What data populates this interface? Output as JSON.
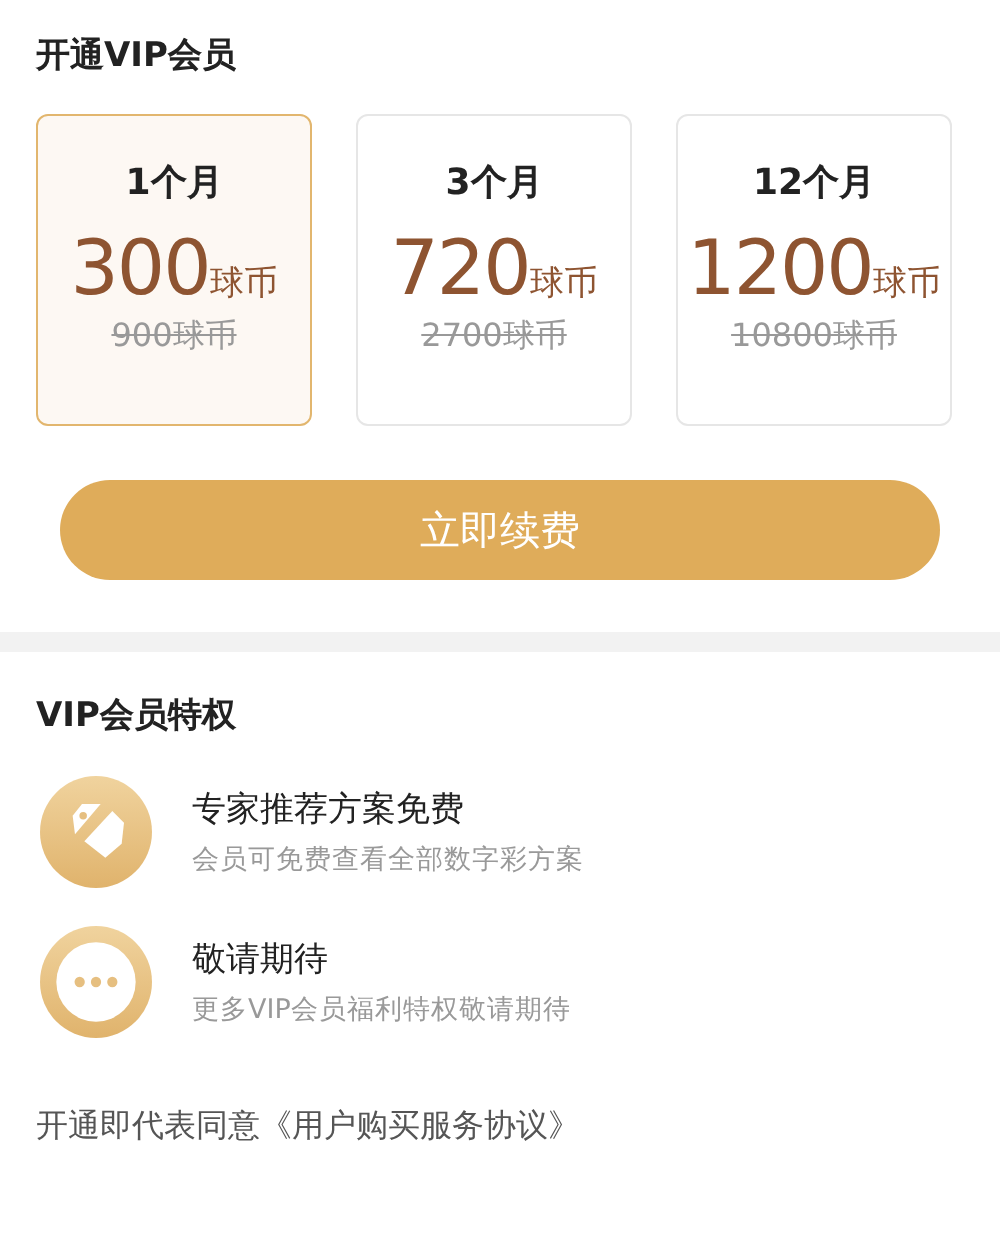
{
  "plan_section": {
    "title": "开通VIP会员",
    "plans": [
      {
        "period": "1个月",
        "price": "300",
        "unit": "球币",
        "original": "900球币",
        "selected": true
      },
      {
        "period": "3个月",
        "price": "720",
        "unit": "球币",
        "original": "2700球币",
        "selected": false
      },
      {
        "period": "12个月",
        "price": "1200",
        "unit": "球币",
        "original": "10800球币",
        "selected": false
      }
    ],
    "renew_button": "立即续费"
  },
  "privileges": {
    "title": "VIP会员特权",
    "items": [
      {
        "kind": "tag",
        "title": "专家推荐方案免费",
        "description": "会员可免费查看全部数字彩方案"
      },
      {
        "kind": "more",
        "title": "敬请期待",
        "description": "更多VIP会员福利特权敬请期待"
      }
    ]
  },
  "agreement": {
    "text": "开通即代表同意",
    "link": "《用户购买服务协议》"
  }
}
